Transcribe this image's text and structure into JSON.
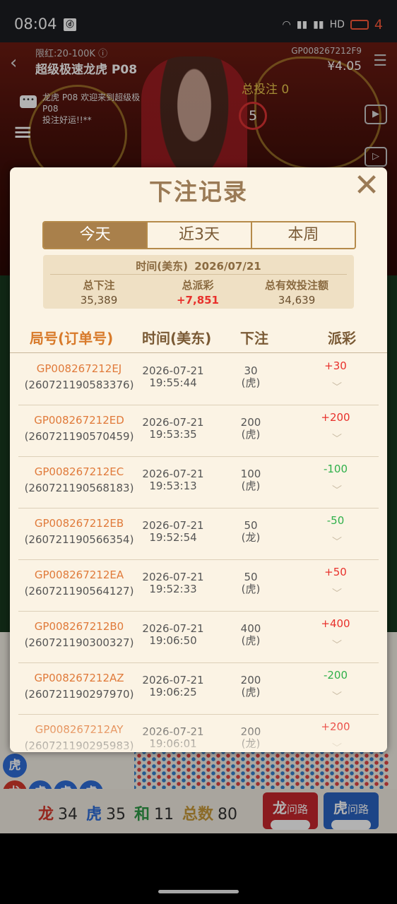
{
  "status": {
    "time": "08:04",
    "app_icon": "ⓓ",
    "right_text": "HD",
    "battery": "4"
  },
  "game": {
    "limit": "限红:20-100K ⓘ",
    "table": "超级极速龙虎 P08",
    "round": "GP008267212F9",
    "balance": "¥4.05",
    "total_bet": "总投注 0",
    "countdown": "5",
    "chat": "龙虎 P08 欢迎来到超级极\nP08\n投注好运!!**",
    "road_stats": {
      "dragon_label": "龙",
      "dragon": "34",
      "tiger_label": "虎",
      "tiger": "35",
      "tie_label": "和",
      "tie": "11",
      "total_label": "总数",
      "total": "80"
    },
    "ask_dragon": {
      "big": "龙",
      "small": "问路"
    },
    "ask_tiger": {
      "big": "虎",
      "small": "问路"
    },
    "road_cells": [
      "虎",
      "龙",
      "虎",
      "虎",
      "虎"
    ]
  },
  "modal": {
    "title": "下注记录",
    "close": "✕",
    "tabs": [
      "今天",
      "近3天",
      "本周"
    ],
    "active_tab": 0,
    "summary": {
      "date_label": "时间(美东)",
      "date": "2026/07/21",
      "total_bet_label": "总下注",
      "total_bet": "35,389",
      "total_payout_label": "总派彩",
      "total_payout": "+7,851",
      "valid_bet_label": "总有效投注额",
      "valid_bet": "34,639"
    },
    "columns": {
      "id": "局号(订单号)",
      "time": "时间(美东)",
      "bet": "下注",
      "payout": "派彩"
    },
    "rows": [
      {
        "id": "GP008267212EJ",
        "order": "(260721190583376)",
        "date": "2026-07-21",
        "time": "19:55:44",
        "amount": "30",
        "side": "(虎)",
        "payout": "+30",
        "win": true
      },
      {
        "id": "GP008267212ED",
        "order": "(260721190570459)",
        "date": "2026-07-21",
        "time": "19:53:35",
        "amount": "200",
        "side": "(虎)",
        "payout": "+200",
        "win": true
      },
      {
        "id": "GP008267212EC",
        "order": "(260721190568183)",
        "date": "2026-07-21",
        "time": "19:53:13",
        "amount": "100",
        "side": "(虎)",
        "payout": "-100",
        "win": false
      },
      {
        "id": "GP008267212EB",
        "order": "(260721190566354)",
        "date": "2026-07-21",
        "time": "19:52:54",
        "amount": "50",
        "side": "(龙)",
        "payout": "-50",
        "win": false
      },
      {
        "id": "GP008267212EA",
        "order": "(260721190564127)",
        "date": "2026-07-21",
        "time": "19:52:33",
        "amount": "50",
        "side": "(虎)",
        "payout": "+50",
        "win": true
      },
      {
        "id": "GP008267212B0",
        "order": "(260721190300327)",
        "date": "2026-07-21",
        "time": "19:06:50",
        "amount": "400",
        "side": "(虎)",
        "payout": "+400",
        "win": true
      },
      {
        "id": "GP008267212AZ",
        "order": "(260721190297970)",
        "date": "2026-07-21",
        "time": "19:06:25",
        "amount": "200",
        "side": "(虎)",
        "payout": "-200",
        "win": false
      },
      {
        "id": "GP008267212AY",
        "order": "(260721190295983)",
        "date": "2026-07-21",
        "time": "19:06:01",
        "amount": "200",
        "side": "(龙)",
        "payout": "+200",
        "win": true
      }
    ],
    "chevron": "﹀"
  },
  "colors": {
    "accent": "#a9804b",
    "win": "#e8302b",
    "loss": "#2fb04a",
    "id_orange": "#e07a3a"
  }
}
